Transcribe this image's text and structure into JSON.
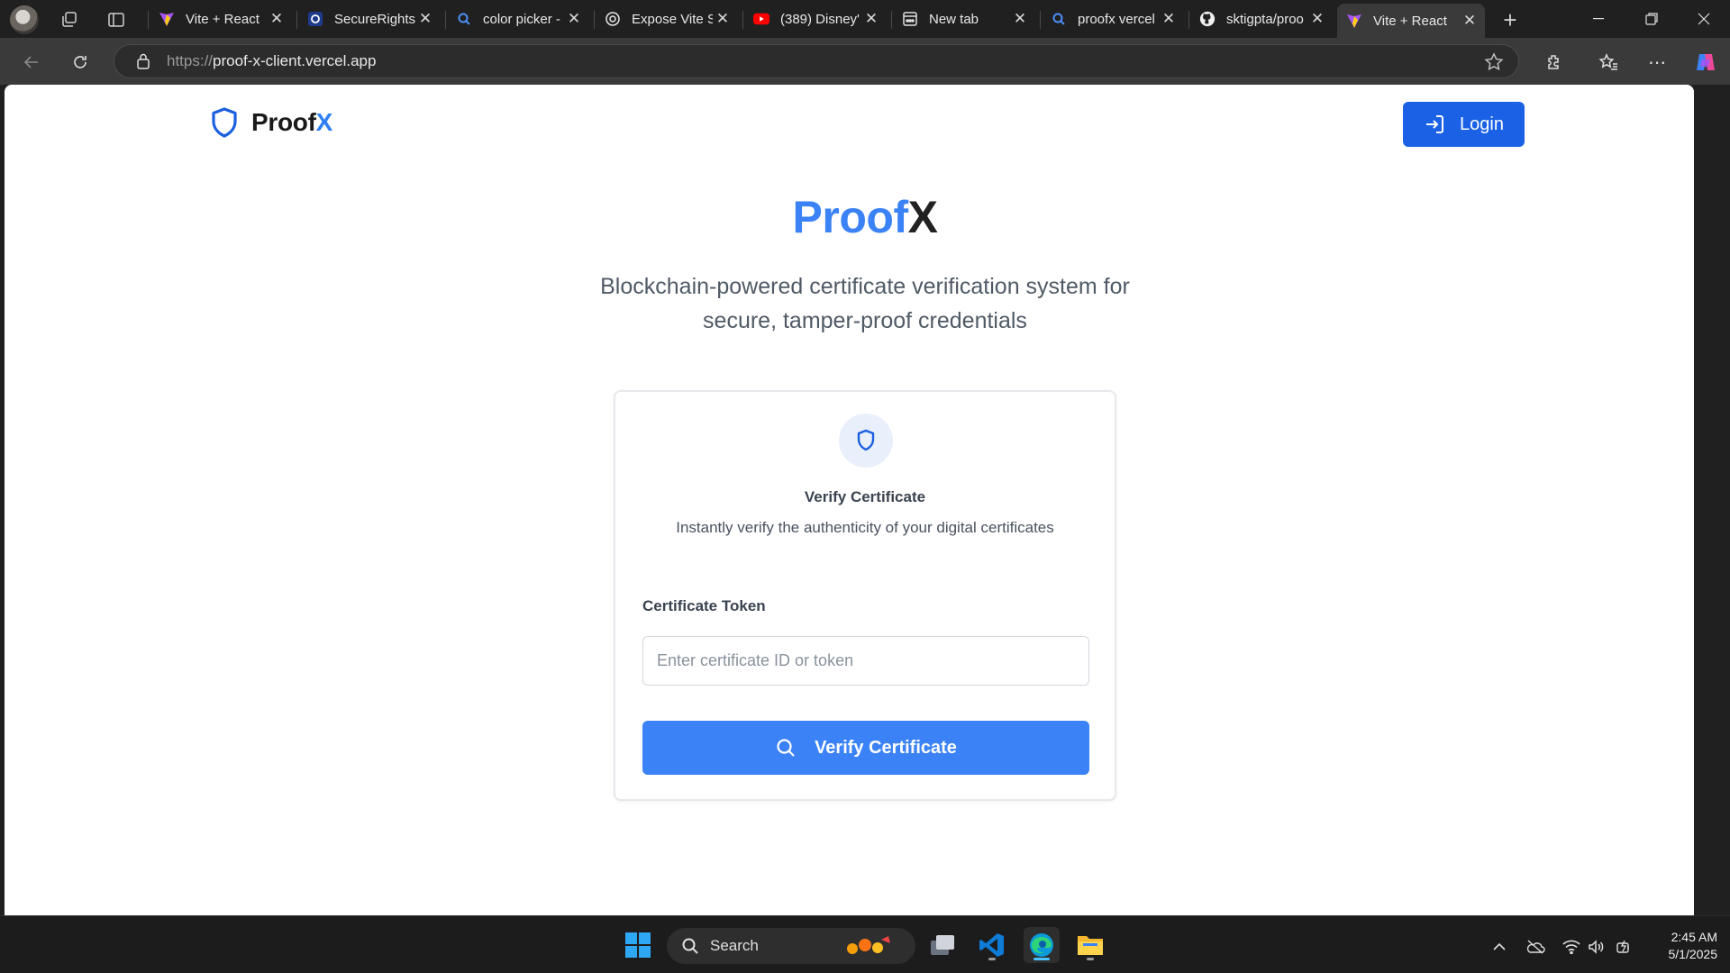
{
  "browser": {
    "tabs": [
      {
        "label": "Vite + React",
        "favicon": "vite-icon"
      },
      {
        "label": "SecureRights",
        "favicon": "securerights-icon"
      },
      {
        "label": "color picker -",
        "favicon": "search-icon"
      },
      {
        "label": "Expose Vite S",
        "favicon": "chatgpt-icon"
      },
      {
        "label": "(389) Disney'",
        "favicon": "youtube-icon"
      },
      {
        "label": "New tab",
        "favicon": "newtab-icon"
      },
      {
        "label": "proofx vercel",
        "favicon": "search-icon"
      },
      {
        "label": "sktigpta/proo",
        "favicon": "github-icon"
      },
      {
        "label": "Vite + React",
        "favicon": "vite-icon",
        "active": true
      }
    ],
    "url_scheme": "https://",
    "url_host": "proof-x-client.vercel.app"
  },
  "header": {
    "brand_prefix": "Proof",
    "brand_suffix": "X",
    "login_label": "Login"
  },
  "hero": {
    "title_prefix": "Proof",
    "title_suffix": "X",
    "subtitle": "Blockchain-powered certificate verification system for secure, tamper-proof credentials"
  },
  "card": {
    "title": "Verify Certificate",
    "description": "Instantly verify the authenticity of your digital certificates",
    "field_label": "Certificate Token",
    "input_placeholder": "Enter certificate ID or token",
    "input_value": "",
    "button_label": "Verify Certificate"
  },
  "taskbar": {
    "search_label": "Search",
    "time": "2:45 AM",
    "date": "5/1/2025"
  },
  "colors": {
    "accent": "#3b82f6",
    "login_button": "#1a61e6",
    "brand_x": "#2f7ef5"
  }
}
